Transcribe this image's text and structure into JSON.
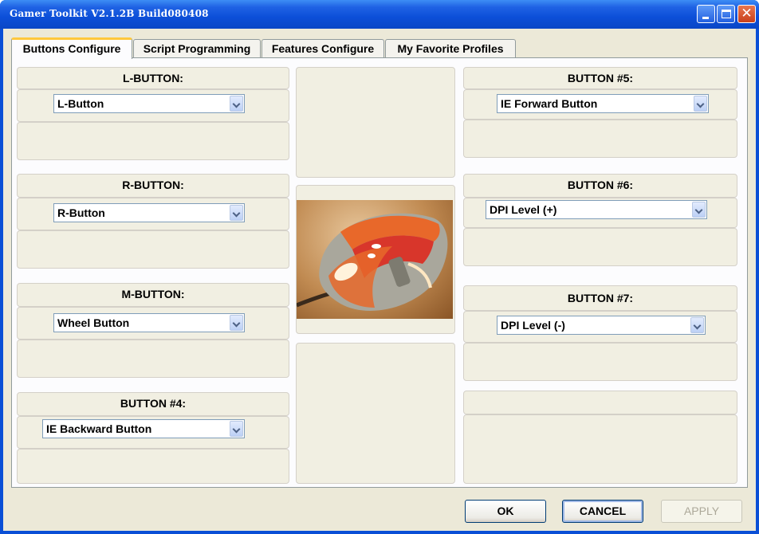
{
  "window": {
    "title": "Gamer Toolkit V2.1.2B Build080408"
  },
  "tabs": [
    {
      "label": "Buttons Configure",
      "active": true
    },
    {
      "label": "Script Programming",
      "active": false
    },
    {
      "label": "Features Configure",
      "active": false
    },
    {
      "label": "My Favorite Profiles",
      "active": false
    }
  ],
  "left_groups": [
    {
      "title": "L-BUTTON:",
      "value": "L-Button"
    },
    {
      "title": "R-BUTTON:",
      "value": "R-Button"
    },
    {
      "title": "M-BUTTON:",
      "value": "Wheel Button"
    },
    {
      "title": "BUTTON #4:",
      "value": "IE Backward Button"
    }
  ],
  "right_groups": [
    {
      "title": "BUTTON #5:",
      "value": "IE Forward Button"
    },
    {
      "title": "BUTTON #6:",
      "value": "DPI Level (+)"
    },
    {
      "title": "BUTTON #7:",
      "value": "DPI Level (-)"
    }
  ],
  "buttons": {
    "ok": "OK",
    "cancel": "CANCEL",
    "apply": "APPLY"
  },
  "colors": {
    "titlebar": "#0a4fd6",
    "tab_highlight": "#ffc83c",
    "dialog_bg": "#ece9d8",
    "mouse_orange": "#e8682a",
    "mouse_red": "#d8362b",
    "mouse_grey": "#a9a79c"
  },
  "icons": {
    "minimize": "minimize-icon",
    "maximize": "maximize-icon",
    "close": "close-icon",
    "dropdown": "chevron-down-icon"
  }
}
